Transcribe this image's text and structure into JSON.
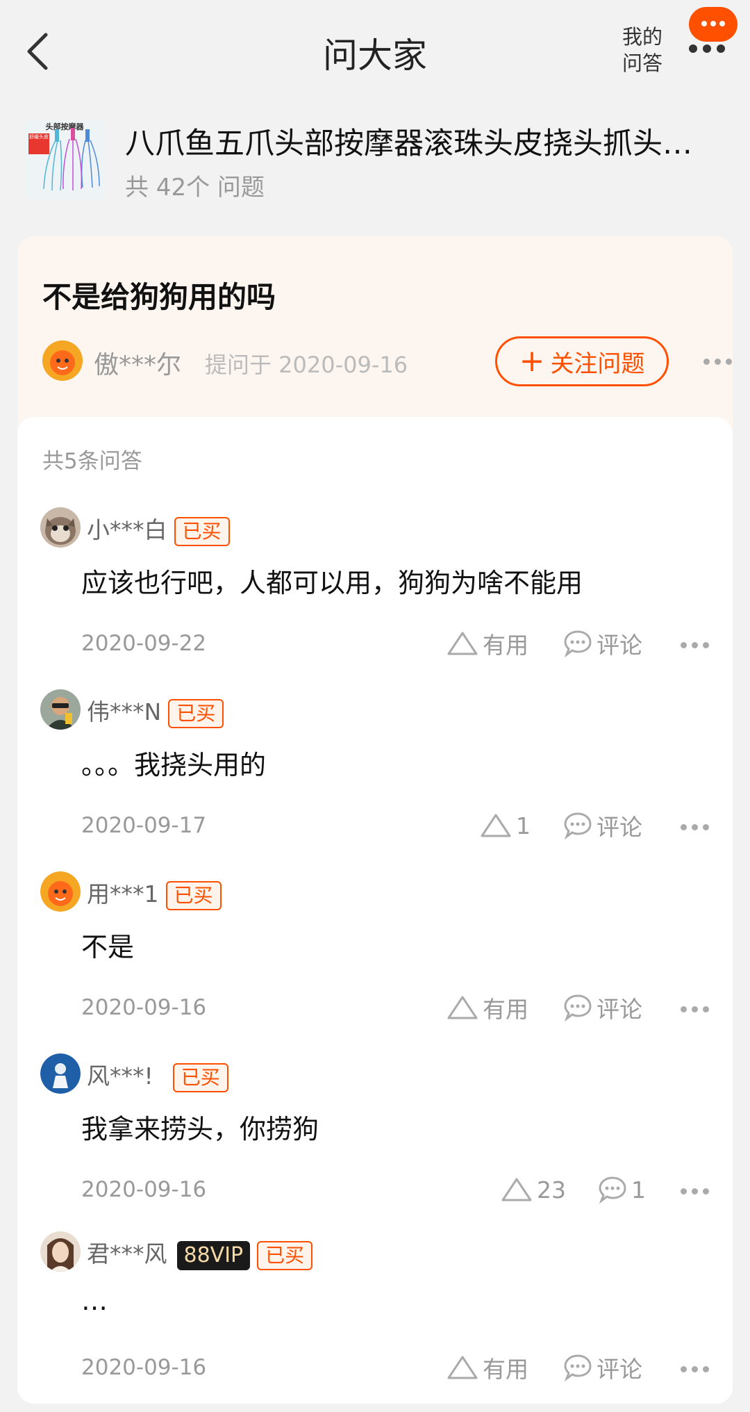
{
  "header": {
    "title": "问大家",
    "my_qa_line1": "我的",
    "my_qa_line2": "问答"
  },
  "product": {
    "name": "八爪鱼五爪头部按摩器滚珠头皮挠头抓头…",
    "question_count": "共 42个 问题",
    "thumb_text_1": "头部按摩器",
    "thumb_text_2": "舒缓头皮"
  },
  "question": {
    "title": "不是给狗狗用的吗",
    "user": "傲***尔",
    "asked_at": "提问于 2020-09-16",
    "follow_label": "关注问题",
    "follow_plus": "+"
  },
  "answers_header": "共5条问答",
  "badges": {
    "bought": "已买",
    "vip": "88VIP"
  },
  "answers": [
    {
      "user": "小***白",
      "text": "应该也行吧，人都可以用，狗狗为啥不能用",
      "date": "2020-09-22",
      "useful": "有用",
      "comment": "评论"
    },
    {
      "user": "伟***N",
      "text": "。。。我挠头用的",
      "date": "2020-09-17",
      "useful": "1",
      "comment": "评论"
    },
    {
      "user": "用***1",
      "text": "不是",
      "date": "2020-09-16",
      "useful": "有用",
      "comment": "评论"
    },
    {
      "user": "风***!",
      "text": "我拿来捞头，你捞狗",
      "date": "2020-09-16",
      "useful": "23",
      "comment": "1"
    },
    {
      "user": "君***风",
      "text": "…",
      "date": "2020-09-16",
      "useful": "有用",
      "comment": "评论"
    }
  ],
  "colors": {
    "accent": "#ff5000",
    "question_bg": "#fdf5f0"
  }
}
